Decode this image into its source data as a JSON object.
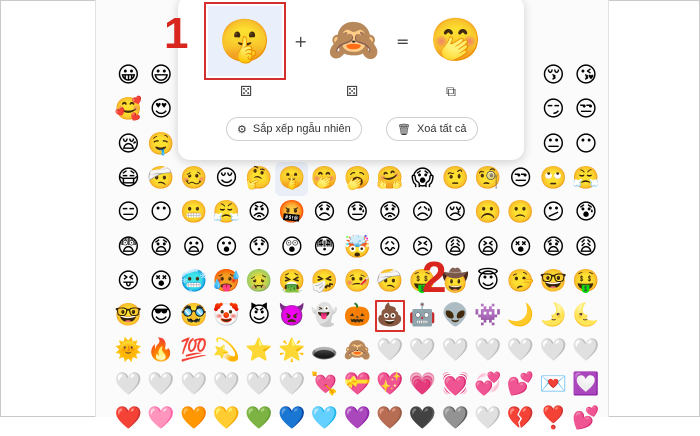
{
  "mixer": {
    "left_emoji": "🤫",
    "plus": "+",
    "middle_emoji": "🙈",
    "equals": "=",
    "result_emoji": "🤭",
    "left_dice": "⚄",
    "middle_dice": "⚄",
    "copy_icon": "⧉",
    "random_button": {
      "icon": "⚙",
      "label": "Sắp xếp ngẫu nhiên"
    },
    "clear_button": {
      "icon": "🗑",
      "label": "Xoá tất cả"
    }
  },
  "annotations": {
    "step1": "1",
    "step2": "2",
    "color": "#d8251d"
  },
  "grid": {
    "rows": [
      [
        "😀",
        "😃",
        "",
        "",
        "",
        "",
        "",
        "",
        "",
        "",
        "",
        "",
        "",
        "😚",
        "😘"
      ],
      [
        "🥰",
        "😍",
        "",
        "",
        "",
        "",
        "",
        "",
        "",
        "",
        "",
        "",
        "",
        "😏",
        "😒"
      ],
      [
        "😪",
        "🤤",
        "",
        "",
        "",
        "",
        "",
        "",
        "",
        "",
        "",
        "",
        "",
        "😐",
        "😶"
      ],
      [
        "😷",
        "🤕",
        "🥴",
        "😌",
        "🤔",
        "🤫",
        "🤭",
        "🥱",
        "🤗",
        "😱",
        "🤨",
        "🧐",
        "😒",
        "🙄",
        "😤"
      ],
      [
        "😑",
        "😶",
        "😬",
        "😤",
        "😡",
        "🤬",
        "😞",
        "😓",
        "😟",
        "😥",
        "😢",
        "☹️",
        "🙁",
        "😕",
        "😰"
      ],
      [
        "😨",
        "😧",
        "😦",
        "😮",
        "😯",
        "😲",
        "😳",
        "🤯",
        "😖",
        "😣",
        "😩",
        "😫",
        "😵",
        "😧",
        "😩"
      ],
      [
        "😝",
        "😵",
        "🥶",
        "🥵",
        "🤢",
        "🤮",
        "🤧",
        "🤒",
        "🤕",
        "🤑",
        "🤠",
        "😇",
        "🤥",
        "🤓",
        "🤑"
      ],
      [
        "🤓",
        "😎",
        "🥸",
        "🤡",
        "😈",
        "👿",
        "👻",
        "🎃",
        "💩",
        "🤖",
        "👽",
        "👾",
        "🌙",
        "🌛",
        "🌜"
      ],
      [
        "🌞",
        "🔥",
        "💯",
        "💫",
        "⭐",
        "🌟",
        "🕳️",
        "🙈",
        "🤍",
        "🤍",
        "🤍",
        "🤍",
        "🤍",
        "🤍",
        "🤍"
      ],
      [
        "🤍",
        "🤍",
        "🤍",
        "🤍",
        "🤍",
        "🤍",
        "💘",
        "💝",
        "💖",
        "💗",
        "💓",
        "💞",
        "💕",
        "💌",
        "💟"
      ],
      [
        "❤️",
        "🩷",
        "🧡",
        "💛",
        "💚",
        "💙",
        "🩵",
        "💜",
        "🤎",
        "🖤",
        "🩶",
        "🤍",
        "💔",
        "❣️",
        "💕"
      ]
    ],
    "selected_cell": "🤫",
    "marked_cell": "💩"
  }
}
